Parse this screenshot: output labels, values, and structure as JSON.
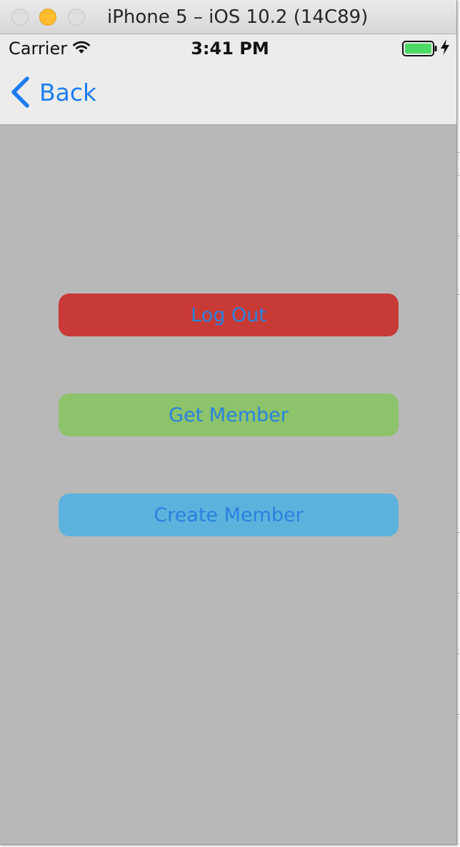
{
  "window": {
    "title": "iPhone 5 – iOS 10.2 (14C89)"
  },
  "status_bar": {
    "carrier": "Carrier",
    "time": "3:41 PM",
    "battery_color": "#4cd964"
  },
  "nav_bar": {
    "back_label": "Back",
    "tint_color": "#1c7ef0"
  },
  "buttons": [
    {
      "label": "Log Out",
      "background": "#c83a36"
    },
    {
      "label": "Get Member",
      "background": "#8cc36b"
    },
    {
      "label": "Create Member",
      "background": "#5db2dd"
    }
  ],
  "colors": {
    "content_background": "#b8b8b8",
    "button_text": "#2a82de"
  },
  "icons": [
    "wifi-icon",
    "battery-icon",
    "charging-bolt-icon",
    "chevron-left-icon"
  ]
}
